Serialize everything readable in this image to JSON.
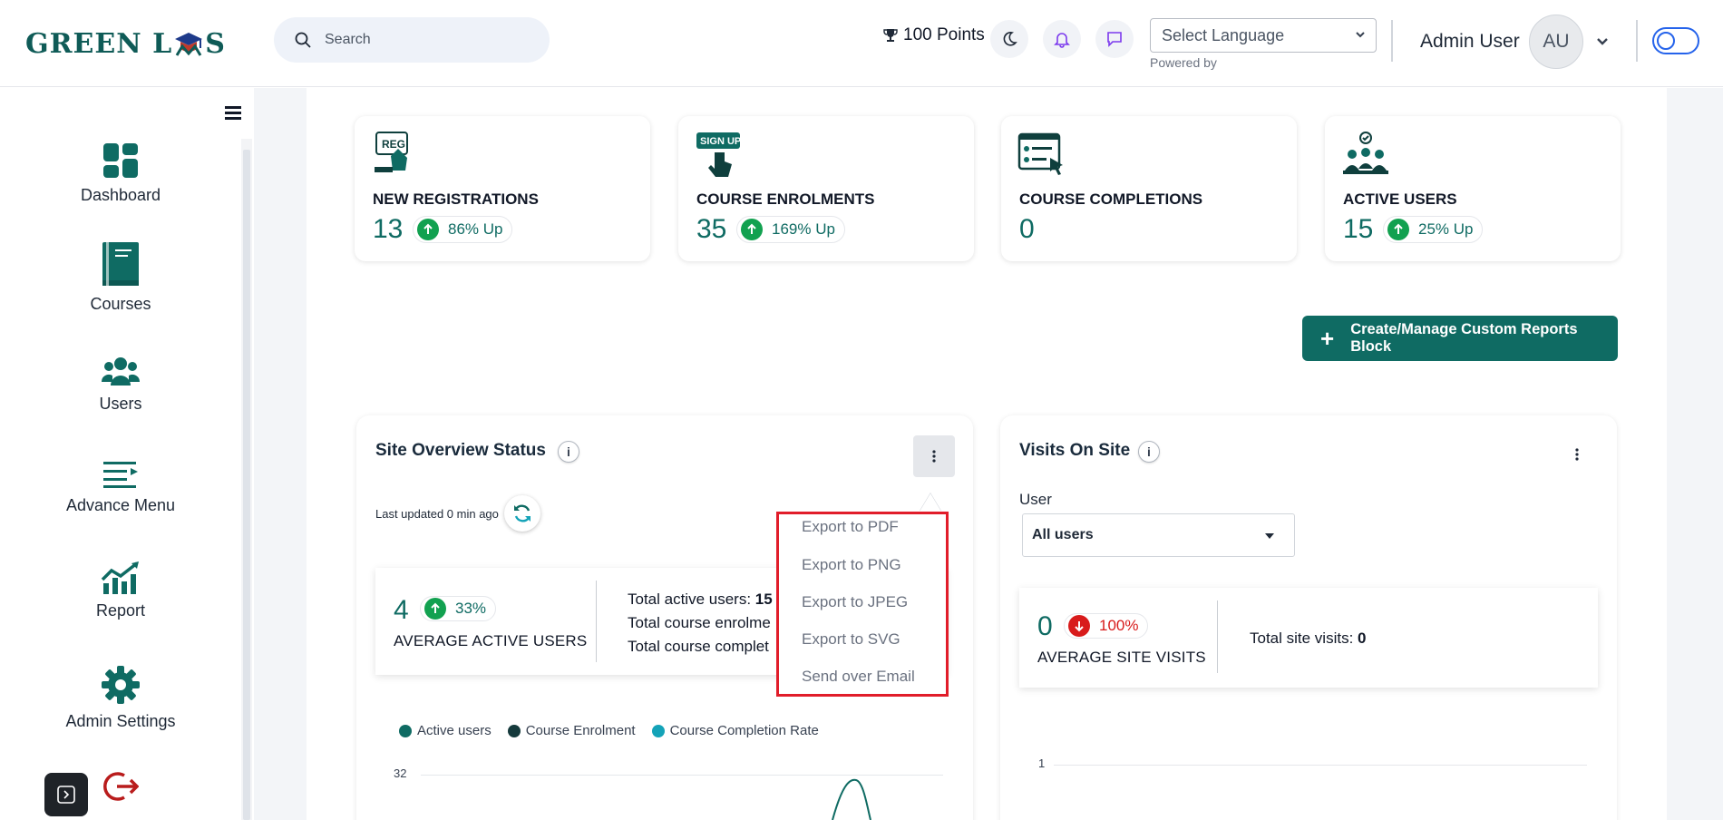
{
  "header": {
    "logo_text_left": "GREEN L",
    "logo_text_right": "S",
    "search_placeholder": "Search",
    "points": "100 Points",
    "language_placeholder": "Select Language",
    "powered_by": "Powered by",
    "user_name": "Admin User",
    "avatar_initials": "AU"
  },
  "sidebar": {
    "items": [
      {
        "label": "Dashboard",
        "icon": "dashboard-icon"
      },
      {
        "label": "Courses",
        "icon": "book-icon"
      },
      {
        "label": "Users",
        "icon": "users-icon"
      },
      {
        "label": "Advance Menu",
        "icon": "list-icon"
      },
      {
        "label": "Report",
        "icon": "chart-icon"
      },
      {
        "label": "Admin Settings",
        "icon": "gear-icon"
      }
    ]
  },
  "stats": [
    {
      "title": "NEW REGISTRATIONS",
      "value": "13",
      "change": "86% Up"
    },
    {
      "title": "COURSE ENROLMENTS",
      "value": "35",
      "change": "169% Up"
    },
    {
      "title": "COURSE COMPLETIONS",
      "value": "0",
      "change": ""
    },
    {
      "title": "ACTIVE USERS",
      "value": "15",
      "change": "25% Up"
    }
  ],
  "create_button": "Create/Manage Custom Reports Block",
  "site_overview": {
    "title": "Site Overview Status",
    "info": "i",
    "last_updated": "Last updated 0 min ago",
    "avg_value": "4",
    "avg_change": "33%",
    "avg_label": "AVERAGE ACTIVE USERS",
    "total_active_label": "Total active users: ",
    "total_active_value": "15",
    "total_enrol_label": "Total course enrolme",
    "total_completion_label": "Total course complet",
    "legend": [
      {
        "label": "Active users",
        "color": "#0f6b63"
      },
      {
        "label": "Course Enrolment",
        "color": "#153a3c"
      },
      {
        "label": "Course Completion Rate",
        "color": "#14a3b8"
      }
    ],
    "y_tick": "32"
  },
  "export_menu": {
    "items": [
      "Export to PDF",
      "Export to PNG",
      "Export to JPEG",
      "Export to SVG",
      "Send over Email"
    ]
  },
  "visits": {
    "title": "Visits On Site",
    "info": "i",
    "user_label": "User",
    "user_select_value": "All users",
    "avg_value": "0",
    "avg_change": "100%",
    "avg_label": "AVERAGE SITE VISITS",
    "total_label": "Total site visits: ",
    "total_value": "0",
    "y_tick": "1"
  },
  "colors": {
    "brand": "#0f6b63",
    "up": "#12a150",
    "down": "#d81b1b",
    "highlight": "#e11d2a"
  }
}
